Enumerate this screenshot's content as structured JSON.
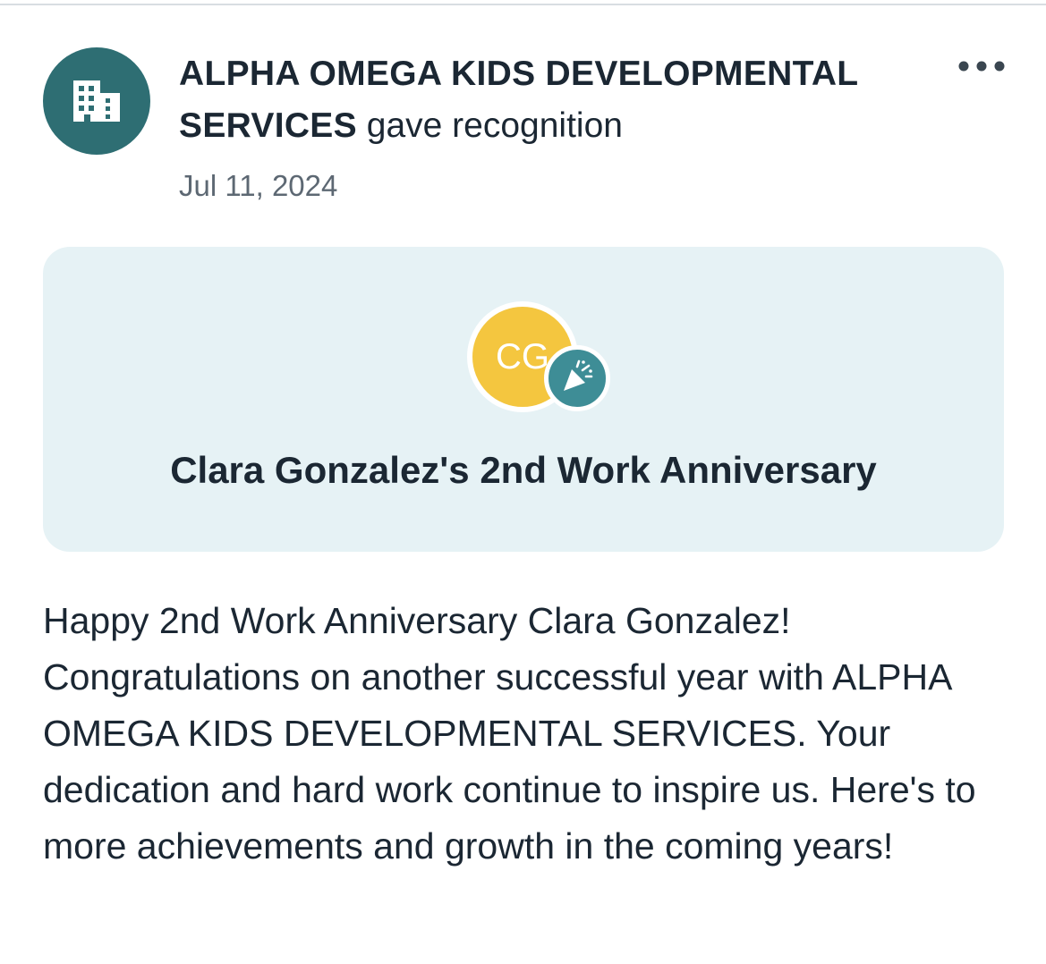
{
  "post": {
    "author": "ALPHA OMEGA KIDS DEVELOPMENTAL SERVICES",
    "action": "gave recognition",
    "date": "Jul 11, 2024",
    "avatar_icon": "building-icon",
    "more_icon": "more-horizontal-icon"
  },
  "recognition": {
    "initials": "CG",
    "badge_icon": "party-popper-icon",
    "title": "Clara Gonzalez's 2nd Work Anniversary"
  },
  "body": {
    "message": "Happy 2nd Work Anniversary Clara Gonzalez! Congratulations on another successful year with ALPHA OMEGA KIDS DEVELOPMENTAL SERVICES. Your dedication and hard work continue to inspire us. Here's to more achievements and growth in the coming years!"
  },
  "colors": {
    "org_avatar_bg": "#2e6e73",
    "card_bg": "#e6f2f5",
    "initials_avatar_bg": "#f4c63f",
    "badge_bg": "#3e8d96",
    "text": "#1b2733",
    "muted_text": "#5d6873"
  }
}
